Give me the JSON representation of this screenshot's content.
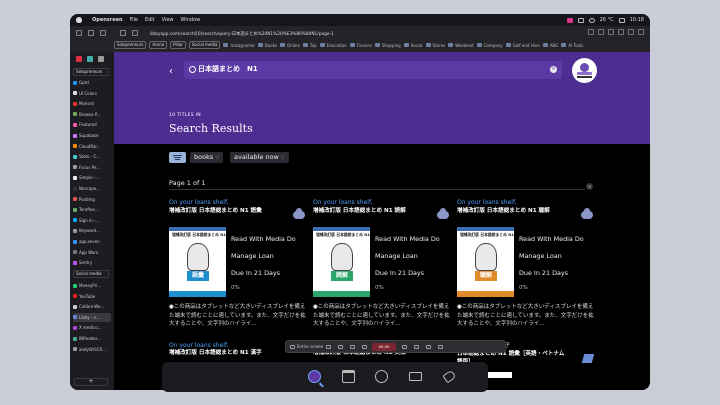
{
  "menubar": {
    "app": "Opensreen",
    "items": [
      "File",
      "Edit",
      "View",
      "Window"
    ],
    "weather": "26 °C",
    "time": "10:18"
  },
  "browser": {
    "url": "libbyapp.com/search/[0]search/query-日本語まとめ%20N1%20%E3%80%80N1/page-1",
    "chips": [
      "Solopreneurs",
      "Arena",
      "Pillar",
      "Social media"
    ],
    "bookmarks": [
      "Instagramer",
      "Books",
      "Online",
      "Top",
      "Education",
      "Finance",
      "Shopping",
      "Social",
      "Stores",
      "Weekend",
      "Company",
      "Golf and Hive",
      "ABG",
      "AI Tools"
    ]
  },
  "sidebar": {
    "group1": "Solopreneurs",
    "items1": [
      "Gptd",
      "UI Colors",
      "Monsrd",
      "Browse P...",
      "Featured",
      "Supabase",
      "Cloudflar...",
      "Stoto - C...",
      "Focus Pe...",
      "Simplo -...",
      "Noscape...",
      "Postlmg",
      "Terafine...",
      "Sign in -...",
      "Keyword...",
      "app.seven",
      "App Worx",
      "Sentry"
    ],
    "group2": "Social media",
    "items2": [
      "MoneyPri...",
      "YouTube",
      "Calibre-We...",
      "Libby - s...",
      "X medico...",
      "INReader...",
      "andyW/SCR..."
    ],
    "add": "+"
  },
  "search": {
    "query": "日本語まとめ　N1",
    "clear_label": "×",
    "back_label": "‹"
  },
  "header": {
    "count": "10 TITLES IN",
    "title": "Search Results"
  },
  "filters": {
    "format": "books",
    "availability": "available now"
  },
  "pagination": {
    "label": "Page 1 of 1"
  },
  "books": [
    {
      "status": "On your loans shelf.",
      "title": "増補改訂版 日本語総まとめ N1 語彙",
      "cover_label": "語彙",
      "cover_color": "#1f8fcf",
      "read": "Read With Media Do",
      "manage": "Manage Loan",
      "due": "Due In 21 Days",
      "progress": "0%",
      "description": "●この商品はタブレットなど大きいディスプレイを備えた端末で読むことに適しています。また、文字だけを拡大することや、文字列のハイライ..."
    },
    {
      "status": "On your loans shelf.",
      "title": "増補改訂版 日本語総まとめ N1 読解",
      "cover_label": "読解",
      "cover_color": "#2ba66b",
      "read": "Read With Media Do",
      "manage": "Manage Loan",
      "due": "Due In 21 Days",
      "progress": "0%",
      "description": "●この商品はタブレットなど大きいディスプレイを備えた端末で読むことに適しています。また、文字だけを拡大することや、文字列のハイライ..."
    },
    {
      "status": "On your loans shelf.",
      "title": "増補改訂版 日本語総まとめ N1 聴解",
      "cover_label": "聴解",
      "cover_color": "#e08a2a",
      "read": "Read With Media Do",
      "manage": "Manage Loan",
      "due": "Due In 21 Days",
      "progress": "0%",
      "description": "●この商品はタブレットなど大きいディスプレイを備えた端末で読むことに適しています。また、文字だけを拡大することや、文字列のハイライ..."
    }
  ],
  "row2": [
    {
      "status": "On your loans shelf.",
      "title": "増補改訂版 日本語総まとめ N1 漢字"
    },
    {
      "status": "On your loans shelf.",
      "title": "増補改訂版 日本語総まとめ N1 文法"
    },
    {
      "author": "松本紀子, 佐々木仁子",
      "title": "日本語総まとめ N1 語彙［英語・ベトナム語版］"
    }
  ],
  "recorder": {
    "entire_screen": "Entire screen",
    "record": "00:00"
  },
  "colors": {
    "hero": "#4e2d91",
    "link": "#4ea3ff",
    "nav_active": "#6aa0ff"
  }
}
